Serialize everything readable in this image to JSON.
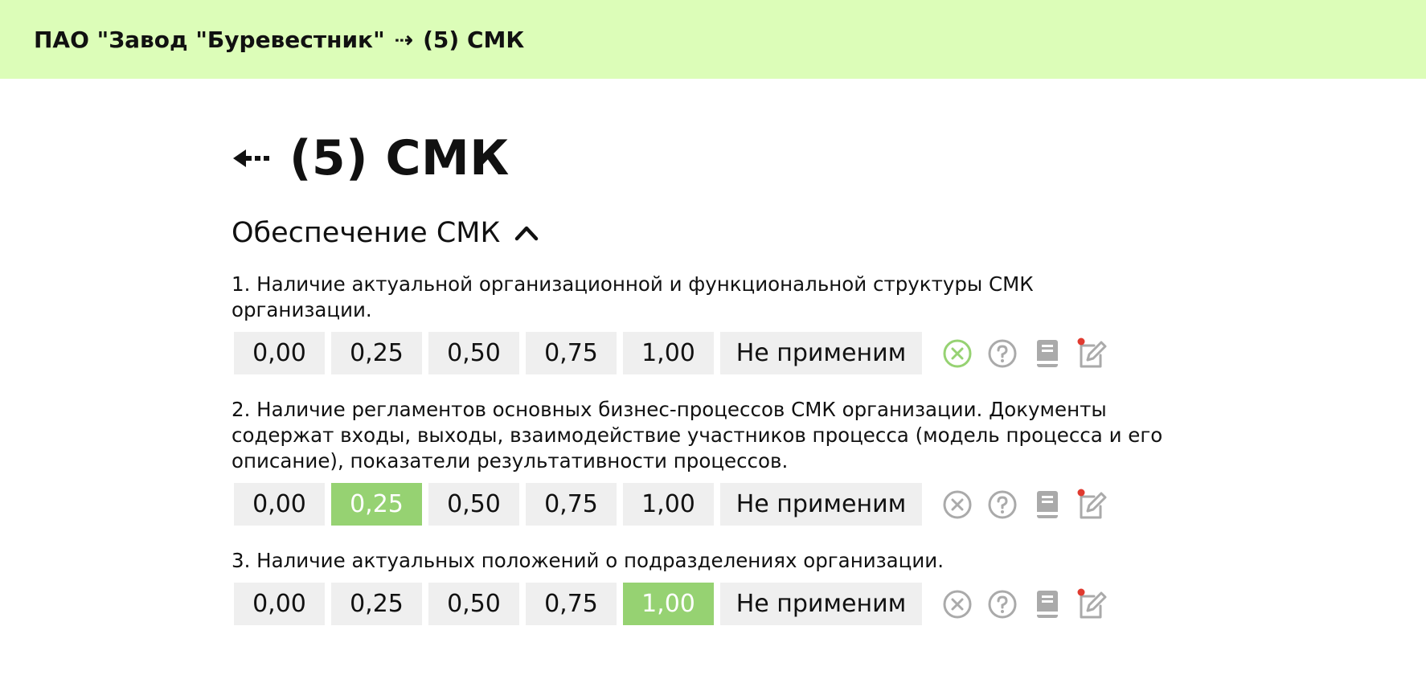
{
  "breadcrumb": {
    "org": "ПАО \"Завод \"Буревестник\"",
    "separator": "⇢",
    "section": "(5) СМК"
  },
  "page": {
    "title": "(5) СМК"
  },
  "section": {
    "title": "Обеспечение СМК"
  },
  "score_options": [
    "0,00",
    "0,25",
    "0,50",
    "0,75",
    "1,00",
    "Не применим"
  ],
  "questions": [
    {
      "text": "1. Наличие актуальной организационной и функциональной структуры СМК организации.",
      "selected": null,
      "clear_active": true
    },
    {
      "text": "2. Наличие регламентов основных бизнес-процессов СМК организации. Документы содержат входы, выходы, взаимодействие участников процесса (модель процесса и его описание), показатели результативности процессов.",
      "selected": "0,25",
      "clear_active": false
    },
    {
      "text": "3. Наличие актуальных положений о подразделениях организации.",
      "selected": "1,00",
      "clear_active": false
    }
  ],
  "colors": {
    "header_bg": "#dcfdb8",
    "selected_bg": "#96d272",
    "button_bg": "#efefef",
    "icon_gray": "#aaaaaa",
    "clear_active_green": "#96d272",
    "note_dot_red": "#e03a2f"
  },
  "icons": {
    "back": "arrow-left-icon",
    "collapse": "chevron-up-icon",
    "clear": "clear-circle-icon",
    "help": "question-circle-icon",
    "book": "book-icon",
    "note": "edit-note-icon"
  }
}
